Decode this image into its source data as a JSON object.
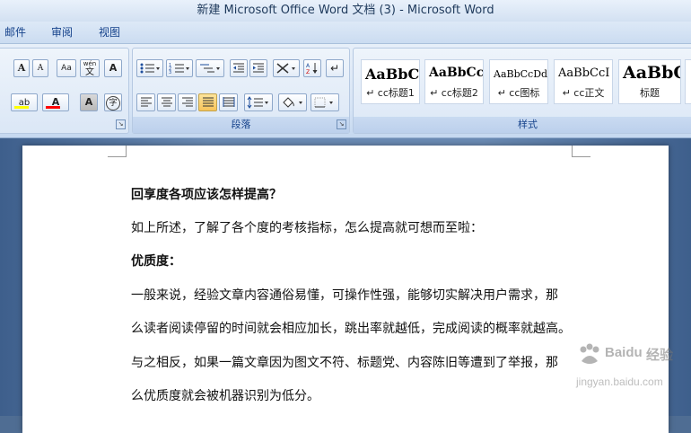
{
  "window": {
    "title": "新建 Microsoft Office Word 文档 (3) - Microsoft Word"
  },
  "menu": {
    "items": [
      "邮件",
      "审阅",
      "视图"
    ]
  },
  "ribbon": {
    "groups": {
      "paragraph": "段落",
      "styles": "样式"
    },
    "font_buttons": {
      "grow": "A",
      "shrink": "A",
      "change_case": "Aa",
      "phonetic_top": "wén",
      "phonetic_char": "文",
      "char_border": "A",
      "highlight": "ab",
      "font_color": "A",
      "char_shading": "A",
      "enclose": "字"
    },
    "styles": [
      {
        "sample": "AaBbC",
        "name": "↵ cc标题1"
      },
      {
        "sample": "AaBbCcl",
        "name": "↵ cc标题2"
      },
      {
        "sample": "AaBbCcDdE",
        "name": "↵ cc图标"
      },
      {
        "sample": "AaBbCcI",
        "name": "↵ cc正文"
      },
      {
        "sample": "AaBbC",
        "name": "标题"
      }
    ],
    "colors": {
      "highlight": "#ffff00",
      "font_color": "#ff0000"
    }
  },
  "document": {
    "paragraphs": [
      {
        "text": "回享度各项应该怎样提高？",
        "bold": true
      },
      {
        "text": "如上所述，了解了各个度的考核指标，怎么提高就可想而至啦：",
        "bold": false
      },
      {
        "text": "优质度：",
        "bold": true
      },
      {
        "text": "一般来说，经验文章内容通俗易懂，可操作性强，能够切实解决用户需求，那",
        "bold": false
      },
      {
        "text": "么读者阅读停留的时间就会相应加长，跳出率就越低，完成阅读的概率就越高。",
        "bold": false
      },
      {
        "text": "与之相反，如果一篇文章因为图文不符、标题党、内容陈旧等遭到了举报，那",
        "bold": false
      },
      {
        "text": "么优质度就会被机器识别为低分。",
        "bold": false
      }
    ]
  },
  "watermark": {
    "brand": "Baidu",
    "cn": "经验",
    "url": "jingyan.baidu.com"
  }
}
